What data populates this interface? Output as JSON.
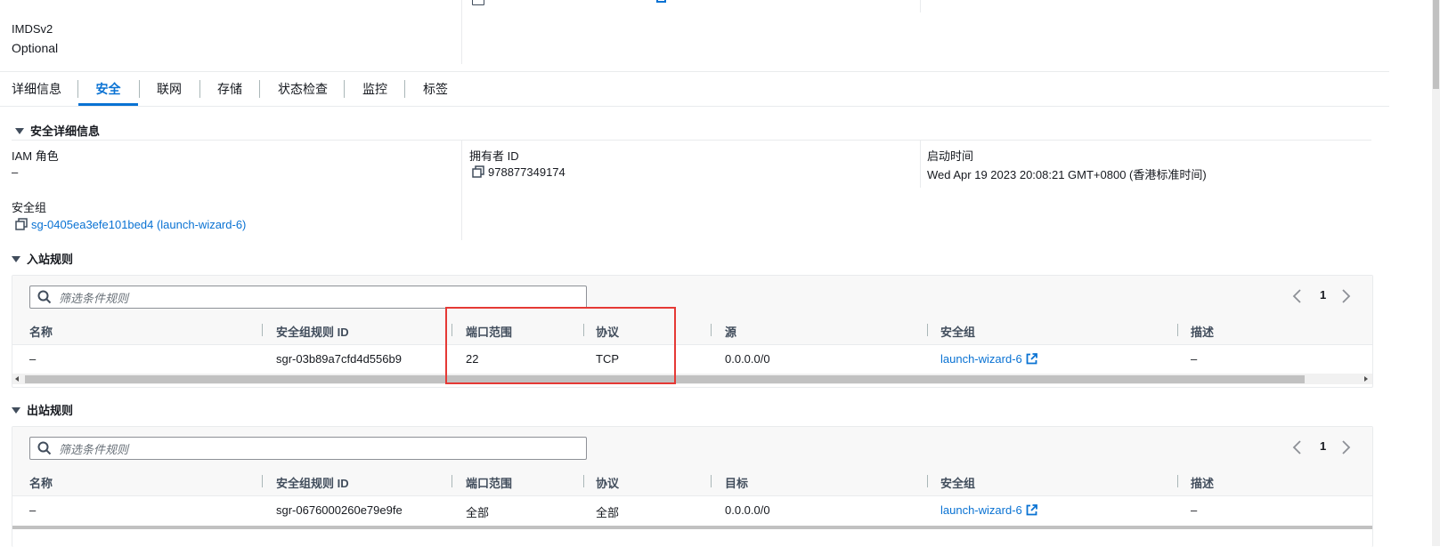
{
  "top": {
    "imds_label": "IMDSv2",
    "imds_value": "Optional"
  },
  "tabs": [
    {
      "label": "详细信息"
    },
    {
      "label": "安全"
    },
    {
      "label": "联网"
    },
    {
      "label": "存储"
    },
    {
      "label": "状态检查"
    },
    {
      "label": "监控"
    },
    {
      "label": "标签"
    }
  ],
  "security_details": {
    "title": "安全详细信息",
    "iam_role_label": "IAM 角色",
    "iam_role_value": "–",
    "owner_id_label": "拥有者 ID",
    "owner_id_value": "978877349174",
    "launch_time_label": "启动时间",
    "launch_time_value": "Wed Apr 19 2023 20:08:21 GMT+0800 (香港标准时间)",
    "sg_label": "安全组",
    "sg_value": "sg-0405ea3efe101bed4 (launch-wizard-6)"
  },
  "inbound": {
    "title": "入站规则",
    "search_placeholder": "筛选条件规则",
    "page": "1",
    "columns": [
      "名称",
      "安全组规则 ID",
      "端口范围",
      "协议",
      "源",
      "安全组",
      "描述"
    ],
    "row": {
      "name": "–",
      "rule_id": "sgr-03b89a7cfd4d556b9",
      "port_range": "22",
      "protocol": "TCP",
      "source": "0.0.0.0/0",
      "security_group": "launch-wizard-6",
      "description": "–"
    }
  },
  "outbound": {
    "title": "出站规则",
    "search_placeholder": "筛选条件规则",
    "page": "1",
    "columns": [
      "名称",
      "安全组规则 ID",
      "端口范围",
      "协议",
      "目标",
      "安全组",
      "描述"
    ],
    "row": {
      "name": "–",
      "rule_id": "sgr-0676000260e79e9fe",
      "port_range": "全部",
      "protocol": "全部",
      "destination": "0.0.0.0/0",
      "security_group": "launch-wizard-6",
      "description": "–"
    }
  },
  "colors": {
    "link": "#0972d3",
    "highlight": "#e53935"
  }
}
